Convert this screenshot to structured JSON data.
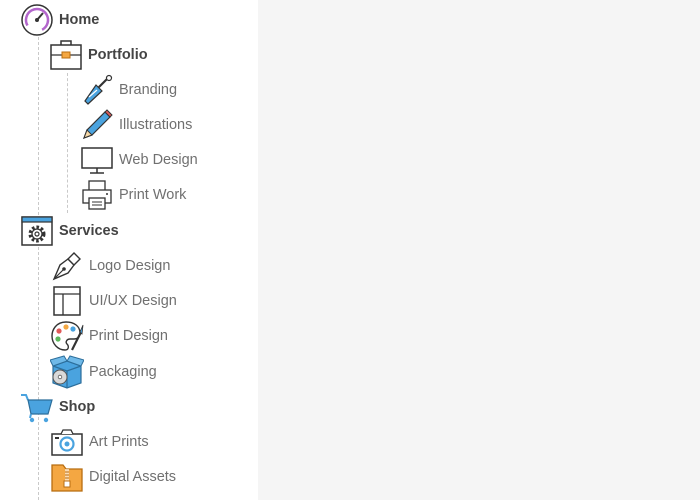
{
  "tree": {
    "home": {
      "label": "Home",
      "icon": "dashboard-gauge-icon"
    },
    "portfolio": {
      "label": "Portfolio",
      "icon": "briefcase-icon",
      "children": [
        {
          "label": "Branding",
          "icon": "paintbrush-icon"
        },
        {
          "label": "Illustrations",
          "icon": "pencil-icon"
        },
        {
          "label": "Web Design",
          "icon": "monitor-icon"
        },
        {
          "label": "Print Work",
          "icon": "printer-icon"
        }
      ]
    },
    "services": {
      "label": "Services",
      "icon": "gear-window-icon",
      "children": [
        {
          "label": "Logo Design",
          "icon": "pen-nib-icon"
        },
        {
          "label": "UI/UX Design",
          "icon": "wireframe-layout-icon"
        },
        {
          "label": "Print Design",
          "icon": "paint-palette-icon"
        },
        {
          "label": "Packaging",
          "icon": "package-box-icon"
        }
      ]
    },
    "shop": {
      "label": "Shop",
      "icon": "shopping-cart-icon",
      "children": [
        {
          "label": "Art Prints",
          "icon": "camera-icon"
        },
        {
          "label": "Digital Assets",
          "icon": "zip-folder-icon"
        }
      ]
    }
  },
  "colors": {
    "parent_text": "#444444",
    "leaf_text": "#707070",
    "accent_blue": "#4aa3df",
    "accent_orange": "#f4a742",
    "content_bg": "#f5f5f5"
  }
}
